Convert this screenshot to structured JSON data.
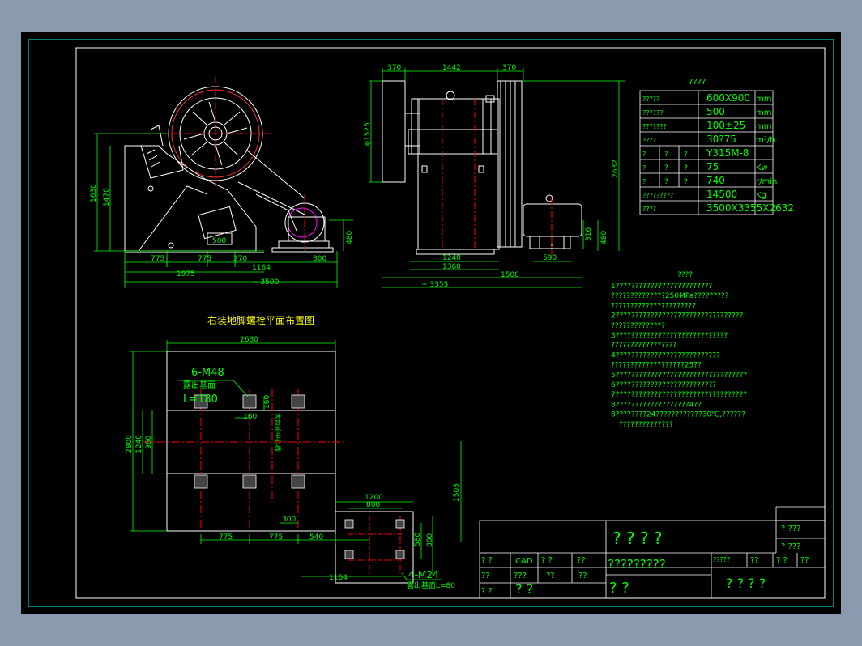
{
  "front_view": {
    "dims": {
      "h1630": "1630",
      "h1470": "1470",
      "h480": "480",
      "d775a": "775",
      "d775b": "775",
      "d270": "270",
      "d1164": "1164",
      "d800": "800",
      "d1975": "1975",
      "d3500": "~ 3500",
      "d500": "500"
    }
  },
  "side_view": {
    "dims": {
      "t370a": "370",
      "t1442": "1442",
      "t370b": "370",
      "dia1525": "φ1525",
      "h2632": "2632",
      "h316": "316",
      "h480": "480",
      "d590": "590",
      "d1240": "1240",
      "d1360": "1360",
      "d1508": "1508",
      "d3355": "~ 3355"
    }
  },
  "spec_table": {
    "title": "????",
    "rows": [
      {
        "label": "?????",
        "c2": "",
        "c3": "",
        "value": "600X900",
        "unit": "mm"
      },
      {
        "label": "??????",
        "c2": "",
        "c3": "",
        "value": "500",
        "unit": "mm"
      },
      {
        "label": "???????",
        "c2": "",
        "c3": "",
        "value": "100±25",
        "unit": "mm"
      },
      {
        "label": "????",
        "c2": "",
        "c3": "",
        "value": "30?75",
        "unit": "m³/h"
      },
      {
        "label": "?",
        "c2": "?",
        "c3": "?",
        "value": "Y315M-8",
        "unit": ""
      },
      {
        "label": "?",
        "c2": "?",
        "c3": "?",
        "value": "75",
        "unit": "Kw"
      },
      {
        "label": "?",
        "c2": "?",
        "c3": "?",
        "value": "740",
        "unit": "r/min"
      },
      {
        "label": "?????????",
        "c2": "",
        "c3": "",
        "value": "14500",
        "unit": "Kg"
      },
      {
        "label": "????",
        "c2": "",
        "c3": "",
        "value": "3500X3355X2632",
        "unit": ""
      }
    ]
  },
  "notes": {
    "title": "????",
    "lines": [
      "1?????????????????????????",
      "??????????????250MPa?????????",
      "??????????????????????",
      "2?????????????????????????????????",
      "??????????????",
      "3?????????????????????????????",
      "?????????????????",
      "4???????????????????????????",
      "???????????????????25??",
      "5??????????????????????????????????",
      "6??????????????????????????",
      "7??????????????????????????????????",
      "8???????????????????4??",
      "8????????24????????????30℃,??????",
      "??????????????"
    ]
  },
  "plan_view": {
    "title": "右装地脚螺栓平面布置图",
    "callout_bolt_main": "6-M48",
    "callout_expose_main": "露出基面",
    "callout_len_main": "L=180",
    "callout_bolt_motor": "4-M24",
    "callout_expose_motor": "露出基面L=80",
    "vertical_label": "大齿轮中心线",
    "dims": {
      "d2630": "2630",
      "d2800": "2800",
      "d1240": "1240",
      "d960": "960",
      "d160a": "160",
      "d160b": "160",
      "d775a": "775",
      "d775b": "775",
      "d540": "540",
      "d300": "300",
      "d1508": "1508",
      "d1200": "1200",
      "d800": "800",
      "d580": "580",
      "d800v": "800",
      "d1164": "1164"
    }
  },
  "title_block": {
    "tr1": "? ???",
    "tr2": "? ???",
    "r1": "? ? ? ?",
    "big": "?????????",
    "c1": "? ?",
    "c2": "CAD",
    "c3": "? ?",
    "c4": "??",
    "c5": "??",
    "c6": "???",
    "c7": "??",
    "c8": "??",
    "c9": "? ?",
    "c10": "? ?",
    "c11": "? ?",
    "s1": "?????",
    "s2": "??",
    "s3": "? ?",
    "s4": "??",
    "bottom_right": "? ? ? ?"
  },
  "colors": {
    "background": "#8a9bb0",
    "sheet": "#000000",
    "border": "#00ffff",
    "line": "#ffffff",
    "dim": "#00ff00",
    "text": "#00ff00",
    "center": "#ff0000",
    "title": "#ffff00",
    "motor": "#ff00ff"
  }
}
